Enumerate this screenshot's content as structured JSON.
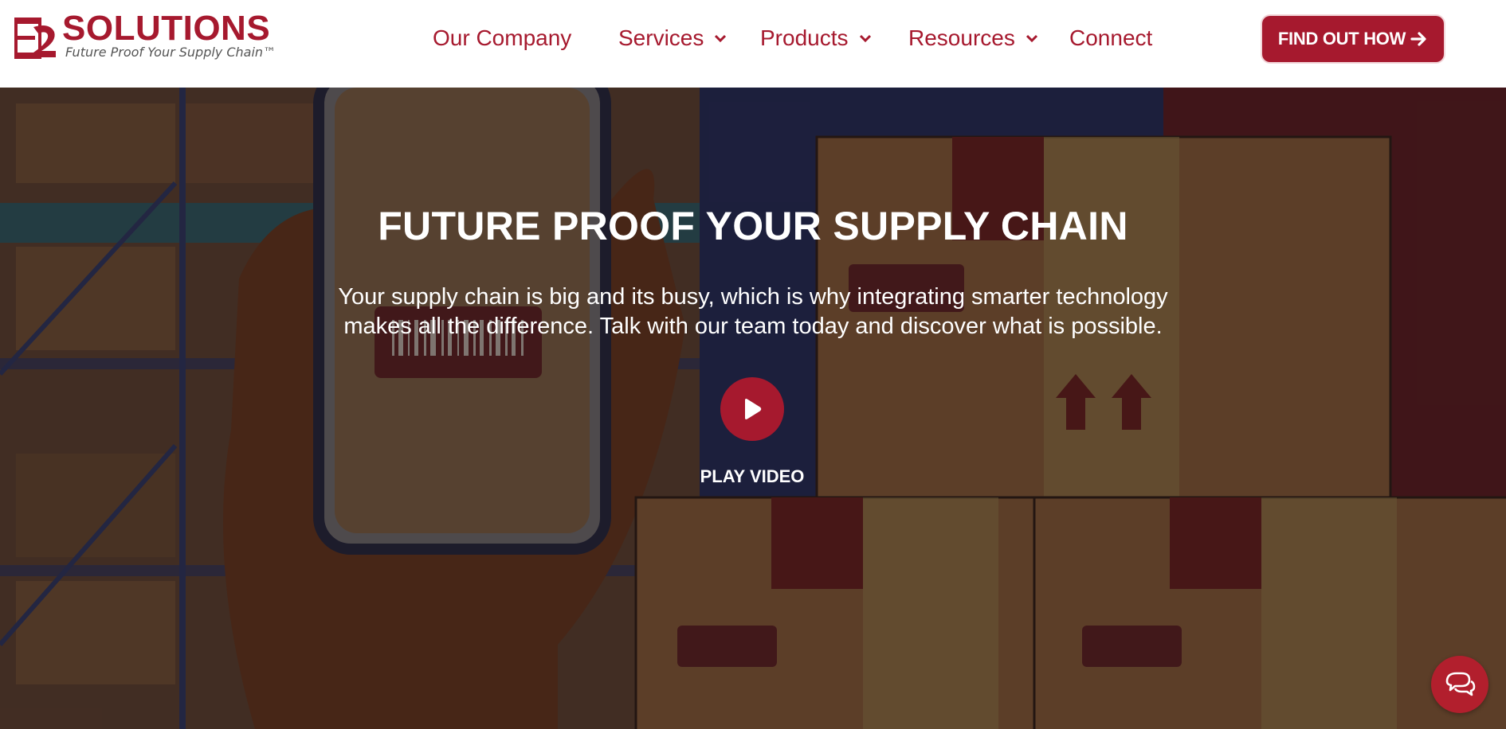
{
  "brand": {
    "name": "SOLUTIONS",
    "tagline": "Future Proof Your Supply Chain™",
    "logo_icon": "e2-logo-icon",
    "accent_color": "#a6192e"
  },
  "nav": {
    "items": [
      {
        "label": "Our Company",
        "has_dropdown": false
      },
      {
        "label": "Services",
        "has_dropdown": true
      },
      {
        "label": "Products",
        "has_dropdown": true
      },
      {
        "label": "Resources",
        "has_dropdown": true
      },
      {
        "label": "Connect",
        "has_dropdown": false
      }
    ],
    "dropdown_icon": "chevron-down-icon"
  },
  "cta": {
    "label": "FIND OUT HOW",
    "icon": "arrow-right-icon"
  },
  "hero": {
    "title": "FUTURE PROOF YOUR SUPPLY CHAIN",
    "text_line1": "Your supply chain is big and its busy, which is why integrating smarter technology",
    "text_line2": "makes all the difference. Talk with our team today and discover what is possible.",
    "play_label": "PLAY VIDEO",
    "play_icon": "play-icon",
    "background": "warehouse-barcode-scan-illustration"
  },
  "chat": {
    "icon": "chat-bubbles-icon"
  }
}
